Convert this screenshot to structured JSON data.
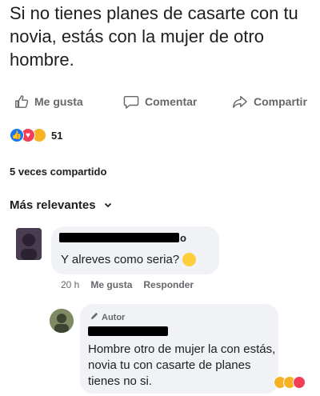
{
  "post": {
    "text": "Si no tienes planes de casarte con tu novia, estás con la mujer de otro hombre."
  },
  "actions": {
    "like": {
      "label": "Me gusta",
      "icon": "thumbs-up-icon"
    },
    "comment": {
      "label": "Comentar",
      "icon": "comment-bubble-icon"
    },
    "share": {
      "label": "Compartir",
      "icon": "share-arrow-icon"
    }
  },
  "reactions": {
    "types": [
      "like",
      "love",
      "wow"
    ],
    "count": "51"
  },
  "shares": {
    "text": "5 veces compartido"
  },
  "sort": {
    "label": "Más relevantes",
    "icon": "chevron-down-icon"
  },
  "comments": [
    {
      "name_visible_tail": "o",
      "text": "Y alreves como seria?",
      "emoji": "thinking-face",
      "time": "20 h",
      "like_label": "Me gusta",
      "reply_label": "Responder"
    },
    {
      "badge": "Autor",
      "badge_icon": "pencil-icon",
      "text": "Hombre otro de mujer la con estás, novia tu con casarte de planes tienes no si.",
      "reactions": [
        "haha",
        "wow",
        "love"
      ]
    }
  ],
  "colors": {
    "text": "#1c1e21",
    "secondary": "#65676b",
    "bubble": "#f0f2f5",
    "like_blue": "#1877f2",
    "love_red": "#f33e58",
    "wow_yellow": "#f7b125"
  }
}
